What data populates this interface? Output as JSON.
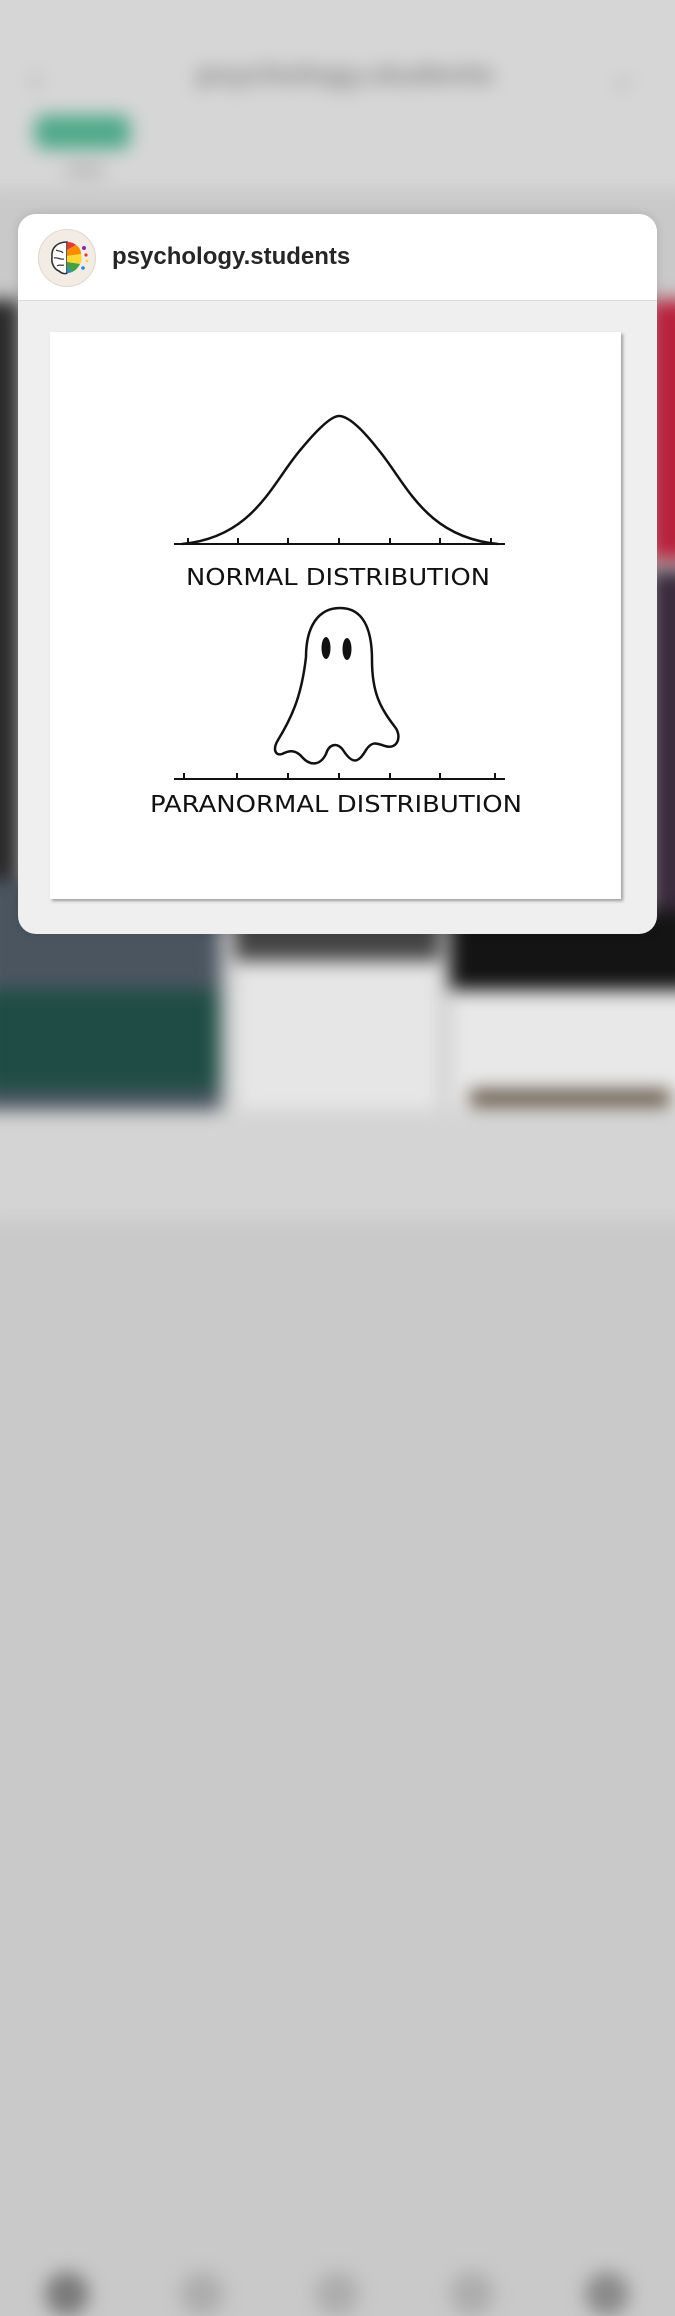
{
  "background": {
    "header_title": "psychology.students",
    "blurred": true
  },
  "card": {
    "username": "psychology.students",
    "avatar_icon": "brain-icon",
    "post": {
      "top_caption": "NORMAL DISTRIBUTION",
      "bottom_caption": "PARANORMAL DISTRIBUTION",
      "top_shape": "bell-curve",
      "bottom_shape": "ghost-icon"
    }
  },
  "colors": {
    "card_background": "#efefef",
    "header_background": "#ffffff",
    "username_text": "#262626",
    "accent_green": "#4fa98a"
  }
}
